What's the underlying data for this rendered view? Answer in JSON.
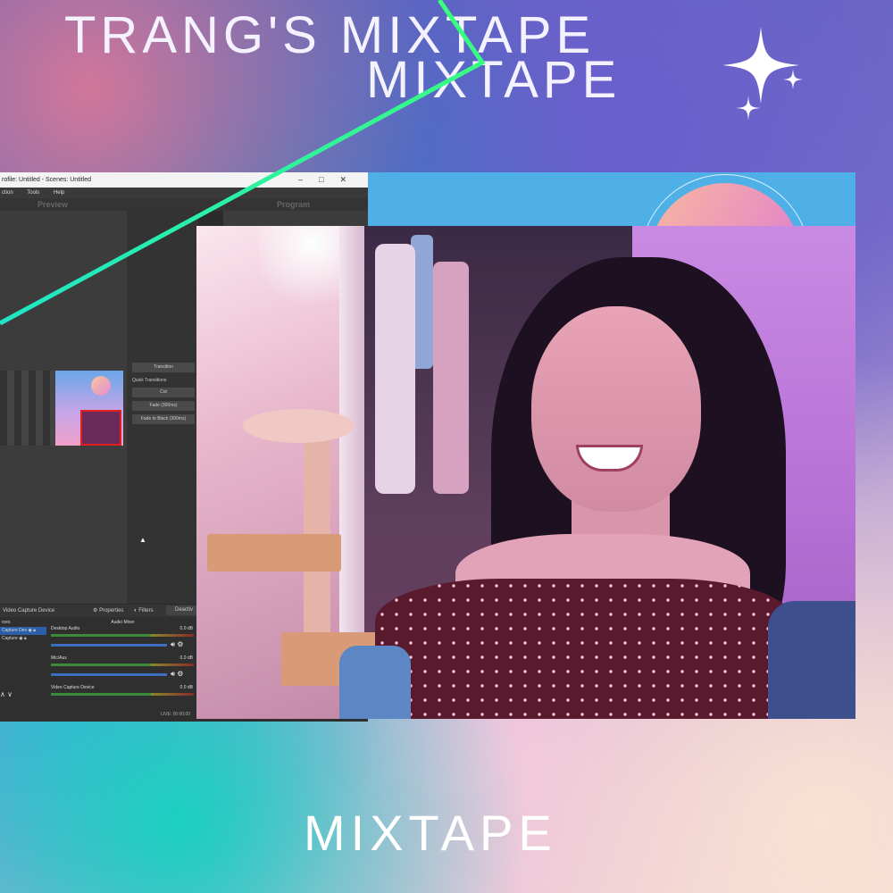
{
  "poster": {
    "title_line1": "TRANG'S MIXTAPE",
    "title_line2": "MIXTAPE",
    "bottom_title": "MIXTAPE"
  },
  "obs": {
    "window_title": "rofile: Untitled - Scenes: Untitled",
    "menu": [
      "ction",
      "Tools",
      "Help"
    ],
    "preview_label": "Preview",
    "program_label": "Program",
    "transitions": {
      "transition_button": "Transition",
      "quick_transitions_label": "Quick Transitions",
      "cut": "Cut",
      "fade": "Fade (300ms)",
      "fade_to_black": "Fade to Black (300ms)"
    },
    "source_toolbar": {
      "selected_source": "Video Capture Device",
      "properties": "Properties",
      "filters": "Filters",
      "deactivate": "Deactiv"
    },
    "sources_header": "rces",
    "sources": [
      "Capture Dev",
      "Capture"
    ],
    "audio_mixer": {
      "title": "Audio Mixer",
      "channels": [
        {
          "name": "Desktop Audio",
          "db": "0.0 dB"
        },
        {
          "name": "Mic/Aux",
          "db": "0.0 dB"
        },
        {
          "name": "Video Capture Device",
          "db": "0.0 dB"
        }
      ]
    },
    "status_bar": "LIVE: 00:00:00"
  },
  "icons": [
    "sparkle-icon",
    "close-icon",
    "minimize-icon",
    "maximize-icon",
    "gear-icon",
    "speaker-icon",
    "eye-icon",
    "lock-icon",
    "arrow-up-icon",
    "arrow-down-icon",
    "cursor-icon"
  ],
  "colors": {
    "neon_line": "#2ef59a",
    "banner_blue": "#4fb0e8",
    "obs_bg": "#2b2b2b",
    "selection_red": "#e02020"
  }
}
